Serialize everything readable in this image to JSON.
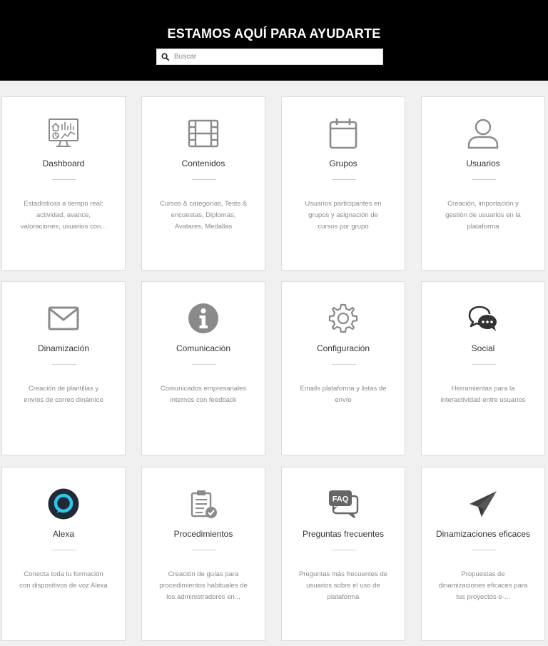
{
  "header": {
    "title": "ESTAMOS AQUÍ PARA AYUDARTE",
    "search_placeholder": "Buscar"
  },
  "cards": [
    {
      "title": "Dashboard",
      "icon": "dashboard-icon",
      "desc": "Estadísticas a tiempo real: actividad, avance, valoraciones, usuarios con..."
    },
    {
      "title": "Contenidos",
      "icon": "film-icon",
      "desc": "Cursos & categorías, Tests & encuestas, Diplomas, Avatares, Medallas"
    },
    {
      "title": "Grupos",
      "icon": "calendar-icon",
      "desc": "Usuarios participantes en grupos y asignación de cursos por grupo"
    },
    {
      "title": "Usuarios",
      "icon": "user-icon",
      "desc": "Creación, importación y gestión de usuarios en la plataforma"
    },
    {
      "title": "Dinamización",
      "icon": "envelope-icon",
      "desc": "Creación de plantillas y envíos de correo dinámico"
    },
    {
      "title": "Comunicación",
      "icon": "info-icon",
      "desc": "Comunicados empresariales internos con feedback"
    },
    {
      "title": "Configuración",
      "icon": "gear-icon",
      "desc": "Emails plataforma y listas de envío"
    },
    {
      "title": "Social",
      "icon": "chat-icon",
      "desc": "Herramientas para la interactividad entre usuarios"
    },
    {
      "title": "Alexa",
      "icon": "alexa-icon",
      "desc": "Conecta toda tu formación con dispositivos de voz Alexa"
    },
    {
      "title": "Procedimientos",
      "icon": "clipboard-check-icon",
      "desc": "Creación de guías para procedimientos habituales de los administradores en..."
    },
    {
      "title": "Preguntas frecuentes",
      "icon": "faq-icon",
      "desc": "Preguntas más frecuentes de usuarios sobre el uso de plataforma"
    },
    {
      "title": "Dinamizaciones eficaces",
      "icon": "paper-plane-icon",
      "desc": "Propuestas de dinamizaciones eficaces para tus proyectos e-..."
    }
  ],
  "colors": {
    "header_bg": "#000000",
    "page_bg": "#f0f0f0",
    "icon_gray": "#8a8a8a",
    "alexa_blue": "#2fc3f0"
  }
}
